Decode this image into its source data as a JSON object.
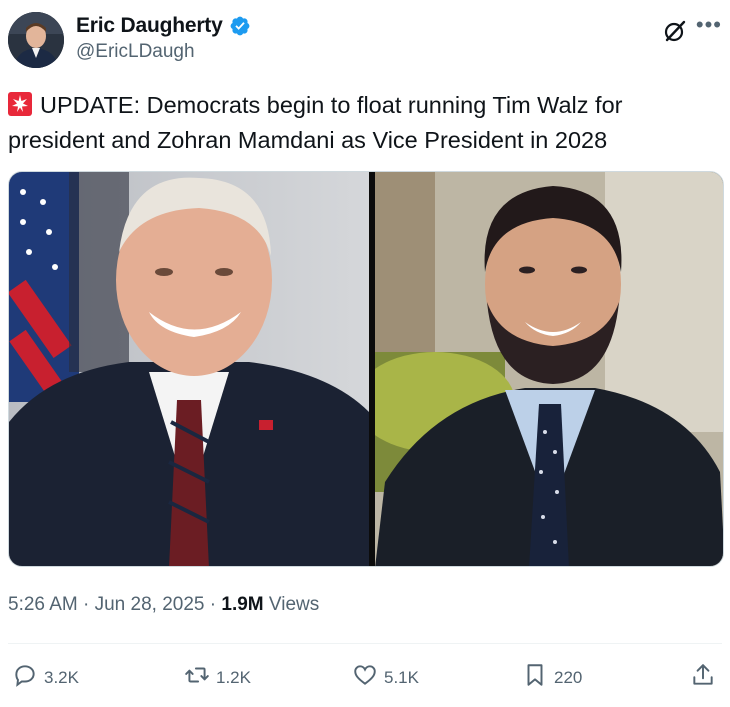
{
  "author": {
    "display_name": "Eric Daugherty",
    "handle": "@EricLDaugh",
    "verified": true
  },
  "tweet": {
    "emoji": "siren-icon",
    "text": "UPDATE: Democrats begin to float running Tim Walz for president and Zohran Mamdani as Vice President in 2028"
  },
  "meta": {
    "time": "5:26 AM",
    "separator1": " · ",
    "date": "Jun 28, 2025",
    "separator2": " · ",
    "views_count": "1.9M",
    "views_label": " Views"
  },
  "actions": {
    "replies": "3.2K",
    "reposts": "1.2K",
    "likes": "5.1K",
    "bookmarks": "220"
  },
  "colors": {
    "verified_blue": "#1d9bf0",
    "secondary_text": "#536471",
    "primary_text": "#0f1419"
  }
}
